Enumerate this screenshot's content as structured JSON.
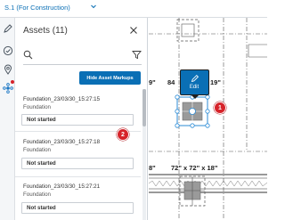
{
  "header": {
    "sheet_label": "S.1 (For Construction)",
    "chevron_icon": "chevron-down-icon"
  },
  "rail": {
    "items": [
      {
        "name": "markup-pen-icon"
      },
      {
        "name": "issues-check-icon"
      },
      {
        "name": "location-pin-icon"
      },
      {
        "name": "assets-icon",
        "active": true,
        "has_notification": true
      }
    ]
  },
  "panel": {
    "title": "Assets (11)",
    "close_icon": "close-icon",
    "search": {
      "placeholder": "",
      "value": ""
    },
    "filter_icon": "filter-icon",
    "hide_button_label": "Hide Asset Markups",
    "assets": [
      {
        "name": "Foundation_23/03/30_15:27:15",
        "type": "Foundation",
        "status": "Not started"
      },
      {
        "name": "Foundation_23/03/30_15:27:18",
        "type": "Foundation",
        "status": "Not started"
      },
      {
        "name": "Foundation_23/03/30_15:27:21",
        "type": "Foundation",
        "status": "Not started"
      }
    ]
  },
  "callouts": {
    "one": "1",
    "two": "2"
  },
  "canvas": {
    "dims": {
      "d1": "9\"",
      "d2": "84",
      "d3": "19\"",
      "d4": "8\"",
      "d5": "72\" x 72\" x 18\""
    },
    "edit_label": "Edit"
  },
  "colors": {
    "accent": "#0a6fb5",
    "badge": "#d6232a",
    "selection": "#2b8bd6"
  }
}
